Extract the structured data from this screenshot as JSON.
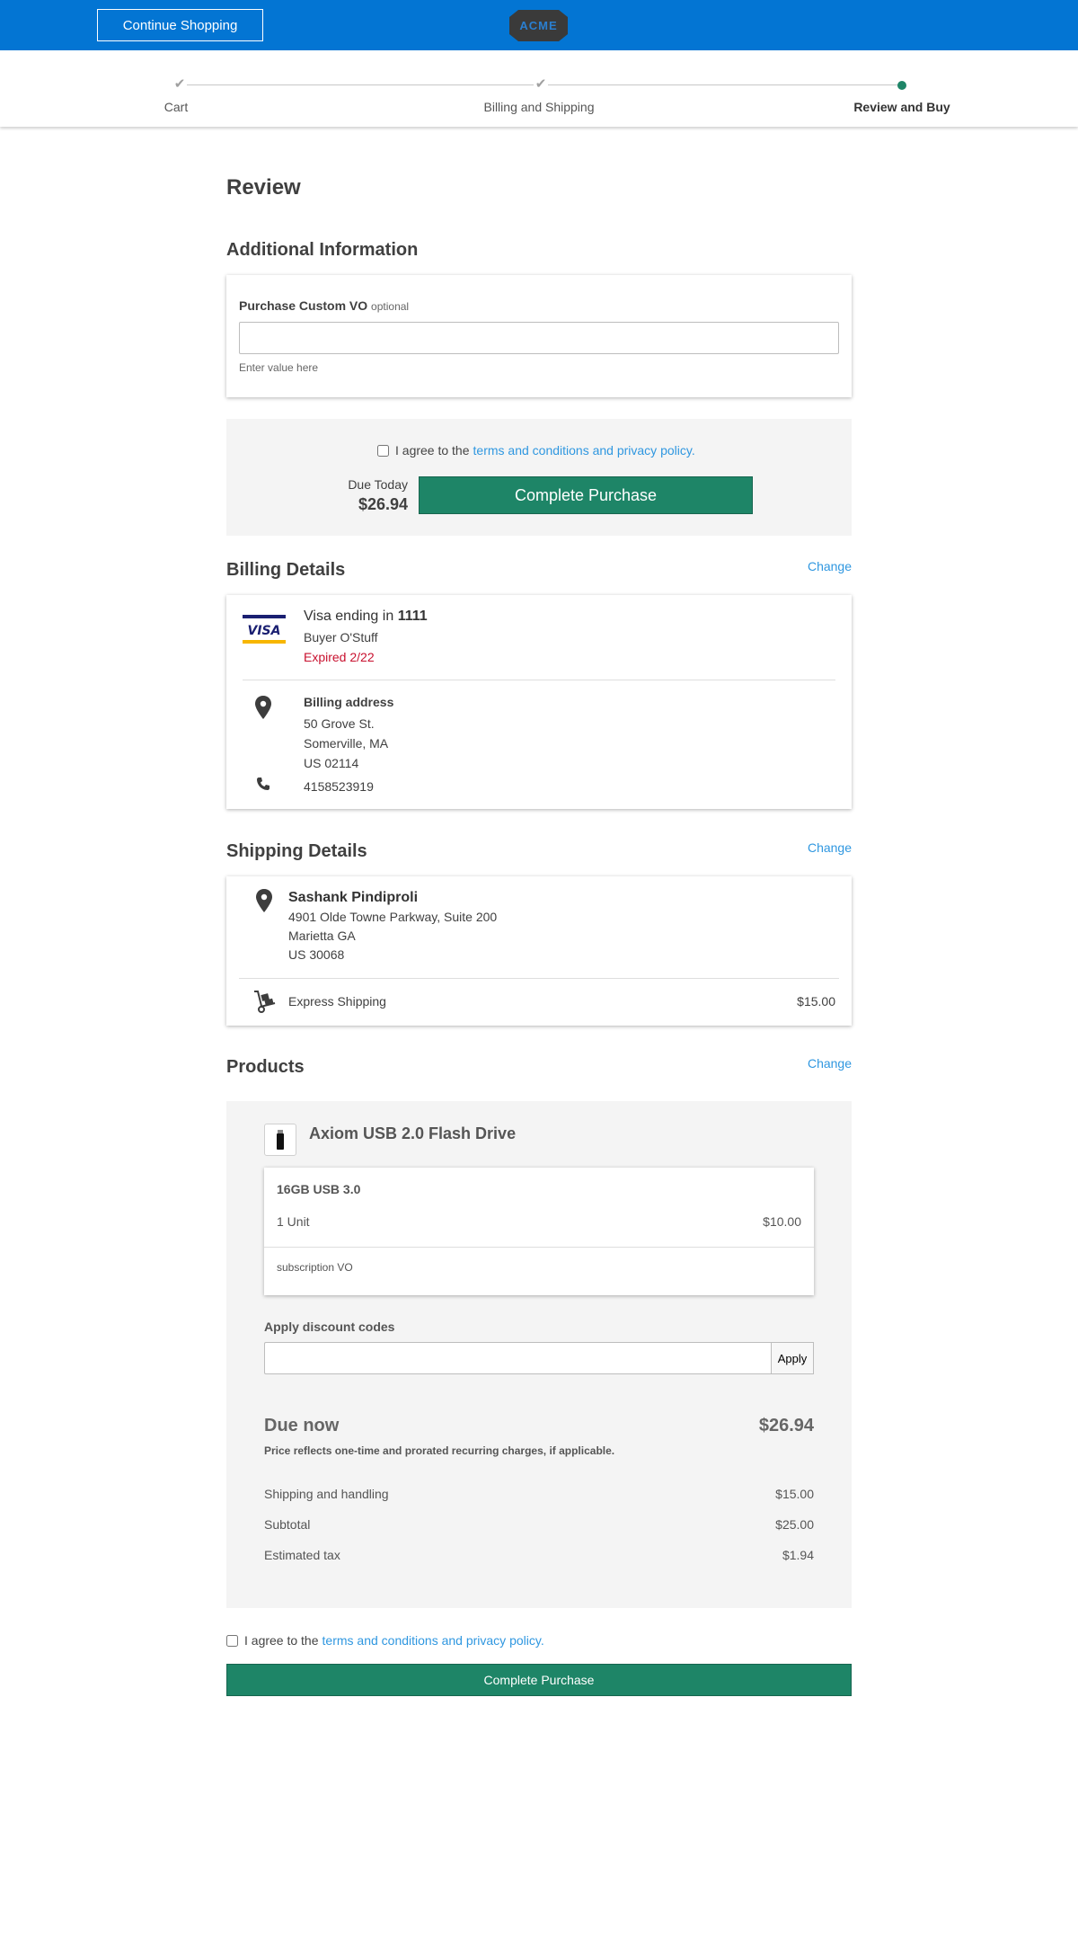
{
  "header": {
    "continue_label": "Continue Shopping",
    "logo_text": "ACME",
    "colors": {
      "bar": "#0375d3",
      "accent_green": "#1e8567",
      "link": "#2f97e0",
      "error": "#c8102e"
    }
  },
  "progress": {
    "steps": [
      {
        "label": "Cart",
        "state": "done"
      },
      {
        "label": "Billing and Shipping",
        "state": "done"
      },
      {
        "label": "Review and Buy",
        "state": "current"
      }
    ]
  },
  "review": {
    "title": "Review",
    "additional_info": {
      "title": "Additional Information",
      "field_label": "Purchase Custom VO",
      "field_optional": "optional",
      "field_value": "",
      "helper": "Enter value here"
    },
    "top_purchase": {
      "agree_text": "I agree to the",
      "agree_link": "terms and conditions and privacy policy.",
      "due_today_label": "Due Today",
      "due_today_amount": "$26.94",
      "button_label": "Complete Purchase"
    }
  },
  "billing": {
    "title": "Billing Details",
    "change_label": "Change",
    "card_brand": "VISA",
    "card_text": "Visa ending in",
    "card_last4": "1111",
    "card_holder": "Buyer O'Stuff",
    "card_status": "Expired 2/22",
    "address_label": "Billing address",
    "address_line1": "50 Grove St.",
    "address_line2": "Somerville, MA",
    "address_line3": "US 02114",
    "phone": "4158523919"
  },
  "shipping": {
    "title": "Shipping Details",
    "change_label": "Change",
    "name": "Sashank Pindiproli",
    "line1": "4901 Olde Towne Parkway, Suite 200",
    "line2": "Marietta GA",
    "line3": "US 30068",
    "method": "Express Shipping",
    "method_price": "$15.00"
  },
  "products": {
    "title": "Products",
    "change_label": "Change",
    "product_name": "Axiom USB 2.0 Flash Drive",
    "variant": "16GB USB 3.0",
    "quantity": "1 Unit",
    "price": "$10.00",
    "note": "subscription VO",
    "discount_label": "Apply discount codes",
    "discount_value": "",
    "apply_label": "Apply",
    "due_now_label": "Due now",
    "due_now_amount": "$26.94",
    "price_note": "Price reflects one-time and prorated recurring charges, if applicable.",
    "lines": [
      {
        "label": "Shipping and handling",
        "amount": "$15.00"
      },
      {
        "label": "Subtotal",
        "amount": "$25.00"
      },
      {
        "label": "Estimated tax",
        "amount": "$1.94"
      }
    ]
  },
  "bottom_purchase": {
    "agree_text": "I agree to the",
    "agree_link": "terms and conditions and privacy policy.",
    "button_label": "Complete Purchase"
  }
}
